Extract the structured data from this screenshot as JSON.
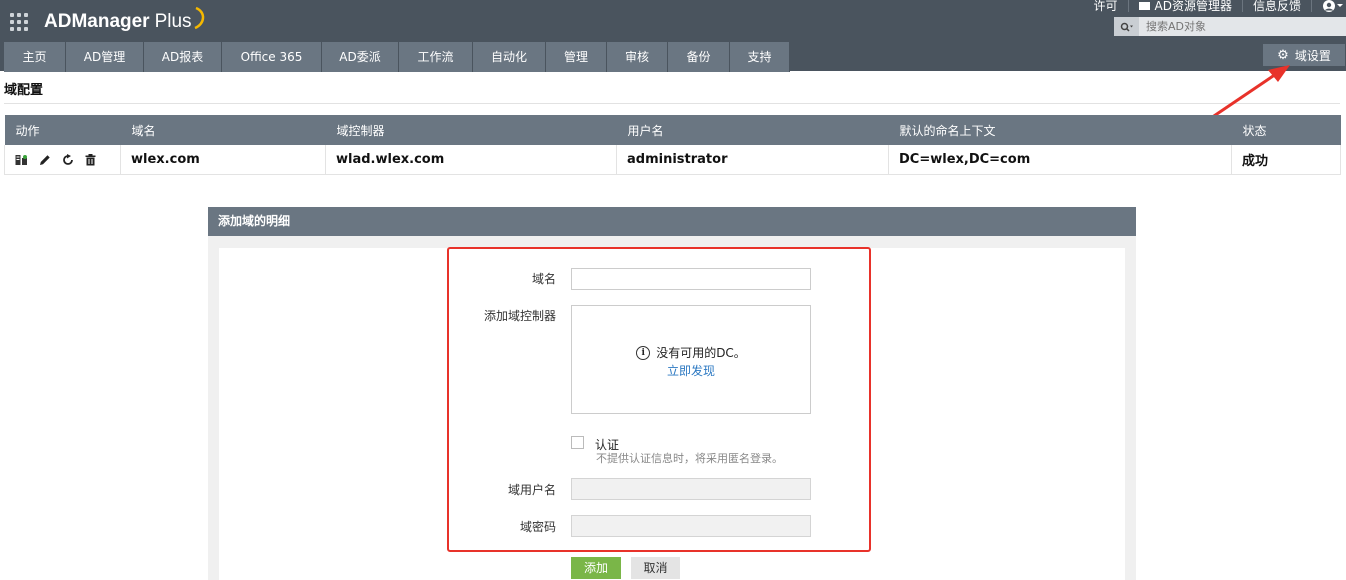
{
  "app": {
    "logo_main": "ADManager",
    "logo_plus": "Plus"
  },
  "top_links": {
    "license": "许可",
    "ad_explorer": "AD资源管理器",
    "feedback": "信息反馈"
  },
  "search": {
    "placeholder": "搜索AD对象"
  },
  "nav": {
    "tabs": [
      {
        "label": "主页"
      },
      {
        "label": "AD管理"
      },
      {
        "label": "AD报表"
      },
      {
        "label": "Office 365"
      },
      {
        "label": "AD委派"
      },
      {
        "label": "工作流"
      },
      {
        "label": "自动化"
      },
      {
        "label": "管理"
      },
      {
        "label": "审核"
      },
      {
        "label": "备份"
      },
      {
        "label": "支持"
      }
    ],
    "domain_settings": "域设置"
  },
  "page": {
    "title": "域配置"
  },
  "table": {
    "headers": {
      "action": "动作",
      "domain": "域名",
      "dc": "域控制器",
      "user": "用户名",
      "context": "默认的命名上下文",
      "status": "状态"
    },
    "rows": [
      {
        "domain": "wlex.com",
        "dc": "wlad.wlex.com",
        "user": "administrator",
        "context": "DC=wlex,DC=com",
        "status": "成功"
      }
    ]
  },
  "form": {
    "header": "添加域的明细",
    "domain_label": "域名",
    "domain_value": "",
    "dc_label": "添加域控制器",
    "no_dc": "没有可用的DC。",
    "discover_now": "立即发现",
    "auth_label": "认证",
    "auth_hint": "不提供认证信息时，将采用匿名登录。",
    "user_label": "域用户名",
    "password_label": "域密码",
    "add_button": "添加",
    "cancel_button": "取消"
  },
  "colors": {
    "topbar": "#4a545e",
    "tab": "#6a7682",
    "highlight": "#e8322a",
    "add_button": "#7ab648",
    "link": "#2b78c2"
  }
}
